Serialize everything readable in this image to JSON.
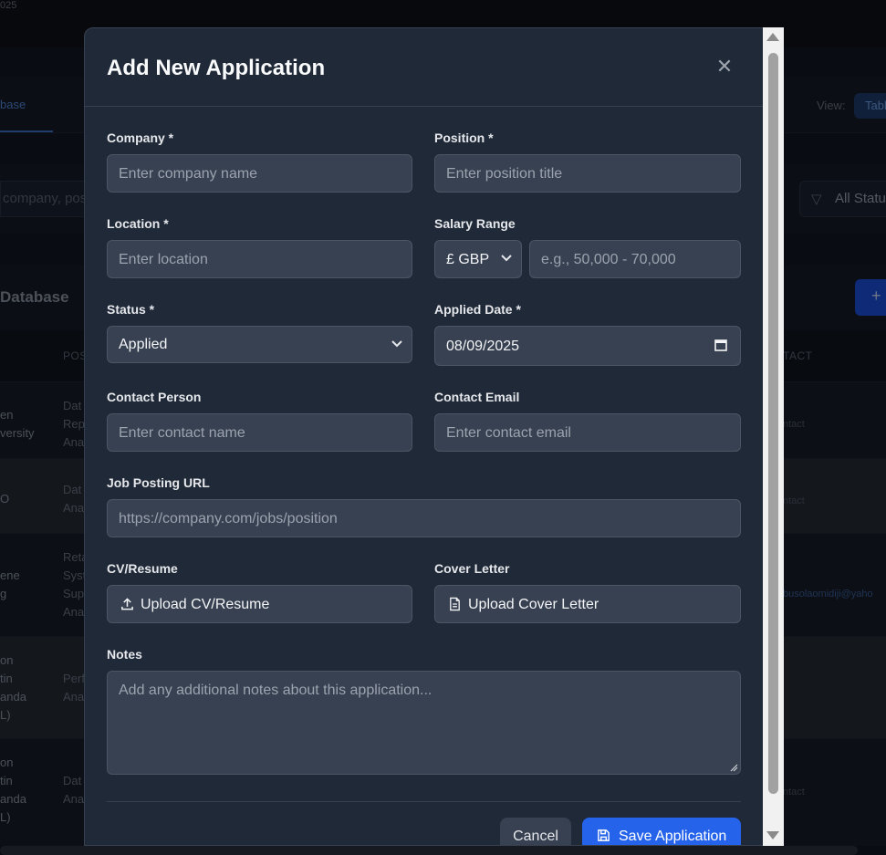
{
  "background": {
    "year_fragment": "025",
    "nav_tab": "base",
    "view_label": "View:",
    "view_button": "Tabl",
    "search_placeholder": "company, pos",
    "filter_label": "All Statu",
    "table_title": "Database",
    "add_button": "+",
    "columns": [
      "POS",
      "TACT"
    ],
    "rows": [
      {
        "company": "en\nversity",
        "position": "Dat\nRep\nAna",
        "contact": "ntact"
      },
      {
        "company": "O",
        "position": "Dat\nAna",
        "contact": "ntact"
      },
      {
        "company": "ene\ng",
        "position": "Reta\nSyst\nSup\nAna",
        "contact": "busolaomidiji@yaho"
      },
      {
        "company": "on\ntin\nanda\nL)",
        "position": "Perf\nAna",
        "contact": ""
      },
      {
        "company": "on\ntin\nanda\nL)",
        "position": "Dat\nAna",
        "contact": "ntact"
      }
    ]
  },
  "modal": {
    "title": "Add New Application",
    "close_icon": "close-icon",
    "company": {
      "label": "Company *",
      "placeholder": "Enter company name"
    },
    "position": {
      "label": "Position *",
      "placeholder": "Enter position title"
    },
    "location": {
      "label": "Location *",
      "placeholder": "Enter location"
    },
    "salary": {
      "label": "Salary Range",
      "currency": "£ GBP",
      "placeholder": "e.g., 50,000 - 70,000"
    },
    "status": {
      "label": "Status *",
      "value": "Applied"
    },
    "applied_date": {
      "label": "Applied Date *",
      "value": "08/09/2025"
    },
    "contact_person": {
      "label": "Contact Person",
      "placeholder": "Enter contact name"
    },
    "contact_email": {
      "label": "Contact Email",
      "placeholder": "Enter contact email"
    },
    "job_url": {
      "label": "Job Posting URL",
      "placeholder": "https://company.com/jobs/position"
    },
    "cv": {
      "label": "CV/Resume",
      "button": "Upload CV/Resume"
    },
    "cover_letter": {
      "label": "Cover Letter",
      "button": "Upload Cover Letter"
    },
    "notes": {
      "label": "Notes",
      "placeholder": "Add any additional notes about this application..."
    },
    "cancel": "Cancel",
    "save": "Save Application"
  },
  "colors": {
    "accent": "#2563eb",
    "modal_bg": "#1f2937",
    "field_bg": "#374151"
  }
}
